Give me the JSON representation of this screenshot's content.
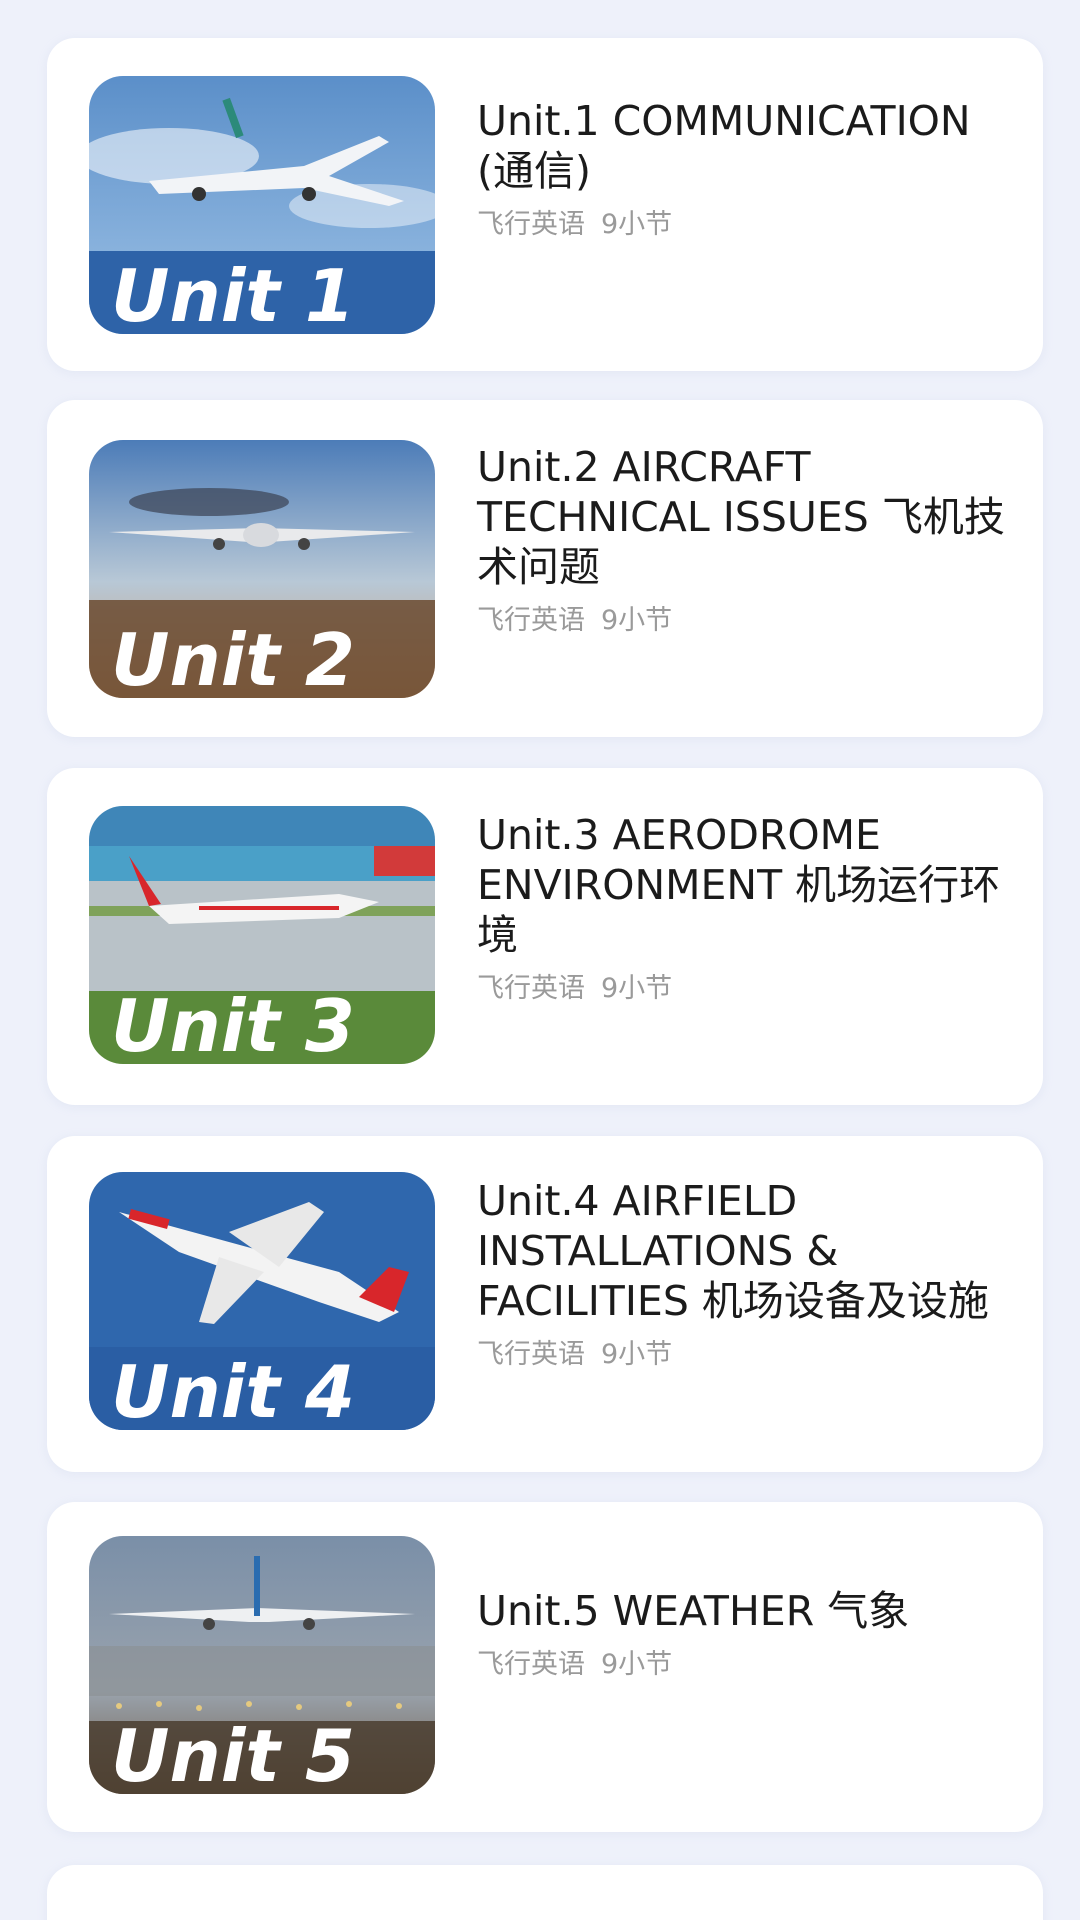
{
  "units": [
    {
      "title": "Unit.1 COMMUNICATION (通信)",
      "category": "飞行英语",
      "lessons": "9小节",
      "badge": "Unit 1",
      "thumb_icon": "airplane-sky-icon",
      "sky_top": "#5b8fc9",
      "sky_bottom": "#9ec2e6"
    },
    {
      "title": "Unit.2 AIRCRAFT TECHNICAL ISSUES  飞机技术问题",
      "category": "飞行英语",
      "lessons": "9小节",
      "badge": "Unit 2",
      "thumb_icon": "airplane-sunset-icon",
      "sky_top": "#4c7cb8",
      "sky_bottom": "#c49a72"
    },
    {
      "title": "Unit.3 AERODROME ENVIRONMENT  机场运行环境",
      "category": "飞行英语",
      "lessons": "9小节",
      "badge": "Unit 3",
      "thumb_icon": "airplane-runway-icon",
      "sky_top": "#3f86b8",
      "sky_bottom": "#b9c2c8"
    },
    {
      "title": "Unit.4 AIRFIELD INSTALLATIONS & FACILITIES 机场设备及设施",
      "category": "飞行英语",
      "lessons": "9小节",
      "badge": "Unit 4",
      "thumb_icon": "airplane-takeoff-icon",
      "sky_top": "#2f67ad",
      "sky_bottom": "#4f86c6"
    },
    {
      "title": "Unit.5 WEATHER 气象",
      "category": "飞行英语",
      "lessons": "9小节",
      "badge": "Unit 5",
      "thumb_icon": "airplane-landing-icon",
      "sky_top": "#7a8fa8",
      "sky_bottom": "#a7a08f"
    }
  ]
}
